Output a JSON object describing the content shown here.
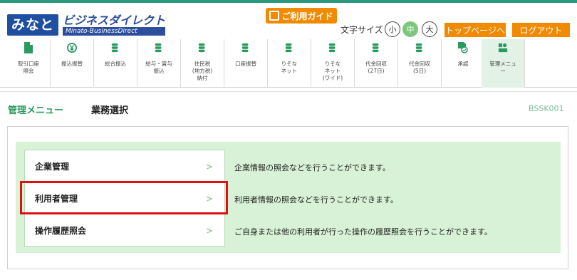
{
  "logo": {
    "main": "みなと",
    "jp": "ビジネスダイレクト",
    "en": "Minato-BusinessDirect"
  },
  "header": {
    "guide_label": "ご利用ガイド",
    "font_size_label": "文字サイズ",
    "font_small": "小",
    "font_mid": "中",
    "font_large": "大",
    "top_page": "トップページへ",
    "logout": "ログアウト"
  },
  "nav": [
    {
      "label": "取引口座\n照会",
      "icon": "document-icon"
    },
    {
      "label": "振込振替",
      "icon": "yen-icon"
    },
    {
      "label": "総合振込",
      "icon": "coins-icon"
    },
    {
      "label": "給与・賞与\n振込",
      "icon": "coins-icon"
    },
    {
      "label": "住民税\n(地方税)\n納付",
      "icon": "coins-icon"
    },
    {
      "label": "口座振替",
      "icon": "coins-icon"
    },
    {
      "label": "りそな\nネット",
      "icon": "coins-icon"
    },
    {
      "label": "りそな\nネット\n(ワイド)",
      "icon": "coins-icon"
    },
    {
      "label": "代金回収\n(27日)",
      "icon": "coins-icon"
    },
    {
      "label": "代金回収\n(5日)",
      "icon": "coins-icon"
    },
    {
      "label": "承認",
      "icon": "approval-icon"
    },
    {
      "label": "管理メニュ\nー",
      "icon": "admin-icon"
    }
  ],
  "breadcrumb": {
    "menu": "管理メニュー",
    "current": "業務選択",
    "screen_id": "BSSK001"
  },
  "menu": [
    {
      "label": "企業管理",
      "description": "企業情報の照会などを行うことができます。"
    },
    {
      "label": "利用者管理",
      "description": "利用者情報の照会などを行うことができます。"
    },
    {
      "label": "操作履歴照会",
      "description": "ご自身または他の利用者が行った操作の履歴照会を行うことができます。"
    }
  ],
  "chevron": ">",
  "colors": {
    "accent": "#2a9a5e",
    "orange": "#f28a00",
    "brand_blue": "#1f4fa0",
    "highlight": "#e01010"
  }
}
